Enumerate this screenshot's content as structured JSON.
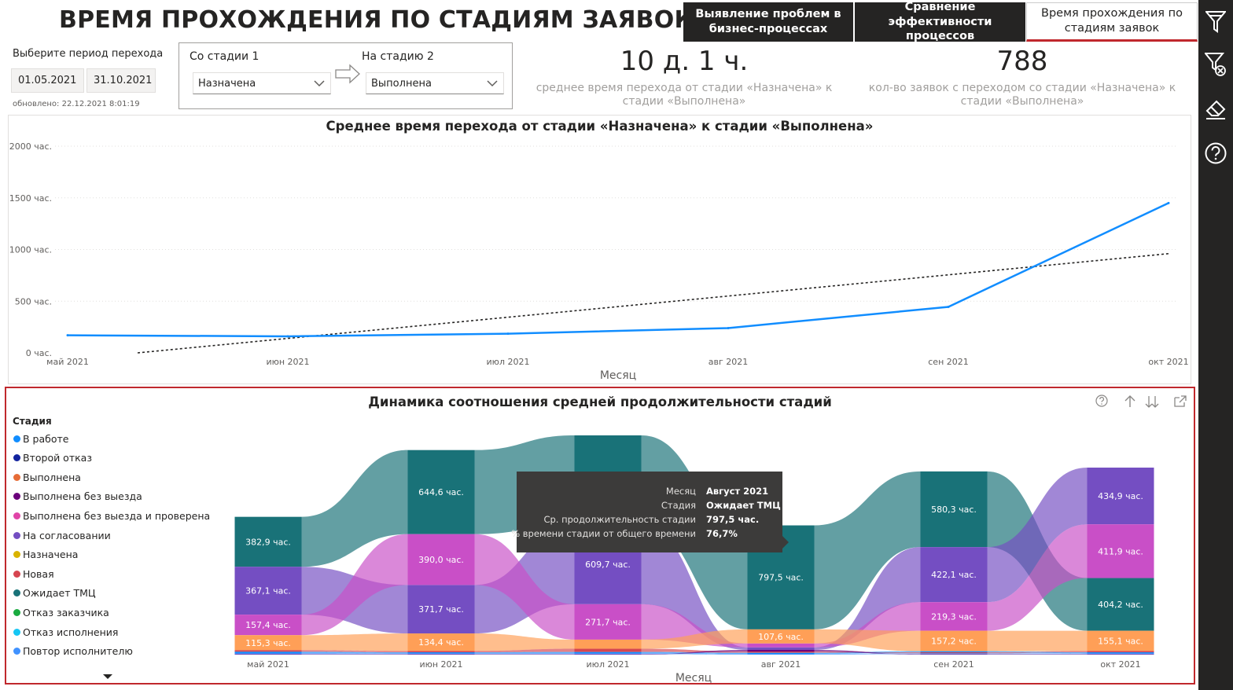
{
  "header": {
    "title": "ВРЕМЯ ПРОХОЖДЕНИЯ ПО СТАДИЯМ ЗАЯВОК",
    "nav": [
      {
        "label": "Выявление проблем в бизнес-процессах",
        "active": false
      },
      {
        "label": "Сравнение эффективности процессов",
        "active": false
      },
      {
        "label": "Время прохождения по стадиям заявок",
        "active": true
      }
    ]
  },
  "toolbar": {
    "icons": [
      "filter-icon",
      "clear-filter-icon",
      "eraser-icon",
      "help-icon"
    ]
  },
  "filters": {
    "period_label": "Выберите период перехода",
    "date_from": "01.05.2021",
    "date_to": "31.10.2021",
    "updated": "обновлено: 22.12.2021 8:01:19",
    "from_stage_label": "Со стадии 1",
    "from_stage_value": "Назначена",
    "to_stage_label": "На стадию 2",
    "to_stage_value": "Выполнена"
  },
  "kpis": [
    {
      "value": "10 д. 1 ч.",
      "label": "среднее время перехода от стадии «Назначена» к стадии «Выполнена»"
    },
    {
      "value": "788",
      "label": "кол-во заявок с переходом со стадии «Назначена» к стадии «Выполнена»"
    }
  ],
  "line_chart": {
    "title": "Среднее время перехода от стадии «Назначена» к стадии «Выполнена»",
    "y_ticks": [
      "0 час.",
      "500 час.",
      "1000 час.",
      "1500 час.",
      "2000 час."
    ],
    "x_ticks": [
      "май 2021",
      "июн 2021",
      "июл 2021",
      "авг 2021",
      "сен 2021",
      "окт 2021"
    ],
    "xlabel": "Месяц"
  },
  "ribbon_chart": {
    "title": "Динамика соотношения средней продолжительности стадий",
    "legend_title": "Стадия",
    "x_ticks": [
      "май 2021",
      "июн 2021",
      "июл 2021",
      "авг 2021",
      "сен 2021",
      "окт 2021"
    ],
    "xlabel": "Месяц",
    "legend": [
      {
        "name": "В работе",
        "color": "#118DFF"
      },
      {
        "name": "Второй отказ",
        "color": "#12239E"
      },
      {
        "name": "Выполнена",
        "color": "#E66C37"
      },
      {
        "name": "Выполнена без выезда",
        "color": "#6B007B"
      },
      {
        "name": "Выполнена без выезда и проверена",
        "color": "#E044A7"
      },
      {
        "name": "На согласовании",
        "color": "#744EC2"
      },
      {
        "name": "Назначена",
        "color": "#D9B300"
      },
      {
        "name": "Новая",
        "color": "#D64550"
      },
      {
        "name": "Ожидает ТМЦ",
        "color": "#197278"
      },
      {
        "name": "Отказ заказчика",
        "color": "#1AAB40"
      },
      {
        "name": "Отказ исполнения",
        "color": "#15C6F4"
      },
      {
        "name": "Повтор исполнителю",
        "color": "#4092FF"
      }
    ]
  },
  "tooltip": {
    "rows": [
      {
        "key": "Месяц",
        "value": "Август 2021"
      },
      {
        "key": "Стадия",
        "value": "Ожидает ТМЦ"
      },
      {
        "key": "Ср. продолжительность стадии",
        "value": "797,5 час."
      },
      {
        "key": "% времени стадии от общего времени",
        "value": "76,7%"
      }
    ]
  },
  "chart_data": [
    {
      "type": "line",
      "title": "Среднее время перехода от стадии «Назначена» к стадии «Выполнена»",
      "xlabel": "Месяц",
      "ylabel": "",
      "ylim": [
        0,
        2000
      ],
      "categories": [
        "май 2021",
        "июн 2021",
        "июл 2021",
        "авг 2021",
        "сен 2021",
        "окт 2021"
      ],
      "series": [
        {
          "values": [
            170,
            160,
            185,
            240,
            445,
            1450
          ],
          "color": "#118DFF",
          "style": "solid"
        },
        {
          "values": [
            -10,
            180,
            370,
            560,
            760,
            960
          ],
          "color": "#252423",
          "style": "dotted",
          "kind": "trend"
        }
      ],
      "grid": true
    },
    {
      "type": "bar",
      "stacked": true,
      "ribbons": true,
      "title": "Динамика соотношения средней продолжительности стадий",
      "xlabel": "Месяц",
      "categories": [
        "май 2021",
        "июн 2021",
        "июл 2021",
        "авг 2021",
        "сен 2021",
        "окт 2021"
      ],
      "series": [
        {
          "name": "Ожидает ТМЦ",
          "color": "#197278",
          "values": [
            382.9,
            644.6,
            684.9,
            797.5,
            580.3,
            404.2
          ],
          "labels": [
            "382,9 час.",
            "644,6 час.",
            "684,9 час.",
            "797,5 час.",
            "580,3 час.",
            "404,2 час."
          ]
        },
        {
          "name": "На согласовании",
          "color": "#744EC2",
          "values": [
            367.1,
            371.7,
            609.7,
            20,
            422.1,
            434.9
          ],
          "labels": [
            "367,1 час.",
            "371,7 час.",
            "609,7 час.",
            "",
            "422,1 час.",
            "434,9 час."
          ]
        },
        {
          "name": "Выполнена без выезда и проверена",
          "color": "#C94FC7",
          "values": [
            157.4,
            390.0,
            271.7,
            30,
            219.3,
            411.9
          ],
          "labels": [
            "157,4 час.",
            "390,0 час.",
            "271,7 час.",
            "",
            "219,3 час.",
            "411,9 час."
          ]
        },
        {
          "name": "Выполнена",
          "color": "#FF9F57",
          "values": [
            115.3,
            134.4,
            70,
            107.6,
            157.2,
            155.1
          ],
          "labels": [
            "115,3 час.",
            "134,4 час.",
            "",
            "107,6 час.",
            "157,2 час.",
            "155,1 час."
          ]
        },
        {
          "name": "Новая",
          "color": "#D64550",
          "values": [
            12,
            10,
            25,
            10,
            8,
            10
          ],
          "labels": [
            "",
            "",
            "",
            "",
            "",
            ""
          ]
        },
        {
          "name": "В работе",
          "color": "#118DFF",
          "values": [
            10,
            8,
            10,
            8,
            8,
            8
          ],
          "labels": [
            "",
            "",
            "",
            "",
            "",
            ""
          ]
        },
        {
          "name": "Выполнена без выезда",
          "color": "#6B007B",
          "values": [
            4,
            4,
            4,
            12,
            4,
            4
          ],
          "labels": [
            "",
            "",
            "",
            "",
            "",
            ""
          ]
        },
        {
          "name": "Повтор исполнителю",
          "color": "#4092FF",
          "values": [
            8,
            6,
            6,
            6,
            6,
            6
          ],
          "labels": [
            "",
            "",
            "",
            "",
            "",
            ""
          ]
        }
      ]
    }
  ]
}
